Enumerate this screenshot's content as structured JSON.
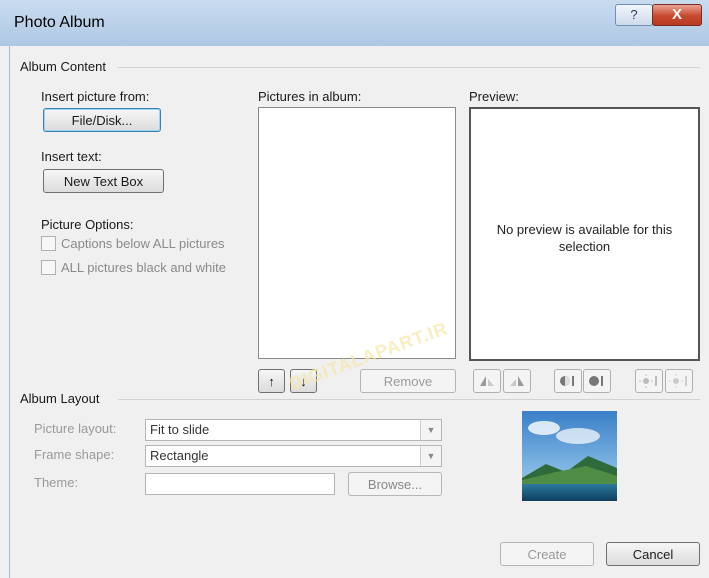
{
  "window": {
    "title": "Photo Album",
    "help_glyph": "?",
    "close_glyph": "X"
  },
  "album_content": {
    "group_label": "Album Content",
    "insert_picture_label": "Insert picture from:",
    "file_disk_button": "File/Disk...",
    "insert_text_label": "Insert text:",
    "new_text_box_button": "New Text Box",
    "picture_options_label": "Picture Options:",
    "captions_checkbox": "Captions below ALL pictures",
    "black_white_checkbox": "ALL pictures black and white",
    "captions_checked": false,
    "black_white_checked": false,
    "pictures_in_album_label": "Pictures in album:",
    "preview_label": "Preview:",
    "preview_message": "No preview is available for this selection",
    "move_up_glyph": "↑",
    "move_down_glyph": "↓",
    "remove_button": "Remove"
  },
  "album_layout": {
    "group_label": "Album Layout",
    "picture_layout_label": "Picture layout:",
    "picture_layout_value": "Fit to slide",
    "frame_shape_label": "Frame shape:",
    "frame_shape_value": "Rectangle",
    "theme_label": "Theme:",
    "theme_value": "",
    "browse_button": "Browse..."
  },
  "footer": {
    "create_button": "Create",
    "cancel_button": "Cancel"
  },
  "watermark": "DIGITALAPART.IR"
}
